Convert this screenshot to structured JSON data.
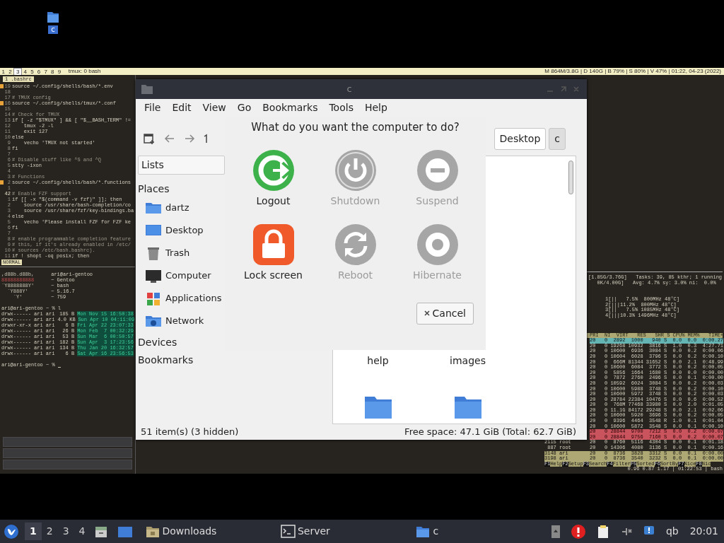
{
  "desktop_icons": [
    {
      "label": "c",
      "selected": true
    }
  ],
  "tmux": {
    "windows": [
      {
        "label": "1",
        "selected": false
      },
      {
        "label": "2",
        "selected": false
      },
      {
        "label": "3",
        "selected": true
      },
      {
        "label": "4",
        "selected": false
      },
      {
        "label": "5",
        "selected": false
      },
      {
        "label": "6",
        "selected": false
      },
      {
        "label": "7",
        "selected": false
      },
      {
        "label": "8",
        "selected": false
      },
      {
        "label": "9",
        "selected": false
      }
    ],
    "title": "tmux: 0 bash",
    "info": "M 864M/3.8G | D 140G | B 79% | S 80% | V 47% | 01:22, 04-23 (2022)"
  },
  "vim": {
    "tab": "1 .bashrc",
    "mode": "NORMAL",
    "lines": [
      {
        "num": "19",
        "text": "source ~/.config/shells/bash/*.env",
        "kind": "code",
        "sign": true
      },
      {
        "num": "18",
        "sign": false
      },
      {
        "num": "17",
        "text": "# TMUX config",
        "kind": "comment",
        "sign": false
      },
      {
        "num": "16",
        "text": "source ~/.config/shells/tmux/*.conf",
        "kind": "code",
        "sign": true
      },
      {
        "num": "15",
        "sign": false
      },
      {
        "num": "14",
        "text": "# Check for TMUX",
        "kind": "comment",
        "sign": false
      },
      {
        "num": "13",
        "text": "if [ -z \"$TMUX\" ] && [ \"$__BASH_TERM\" !=",
        "kind": "code",
        "sign": false
      },
      {
        "num": "12",
        "text": "    tmux -2 -l",
        "kind": "code",
        "sign": false
      },
      {
        "num": "11",
        "text": "    exit 127",
        "kind": "code",
        "sign": false
      },
      {
        "num": "10",
        "text": "else",
        "kind": "code",
        "sign": false
      },
      {
        "num": "9",
        "text": "    vecho 'TMUX not started'",
        "kind": "code",
        "sign": false
      },
      {
        "num": "8",
        "text": "fi",
        "kind": "code",
        "sign": false
      },
      {
        "num": "7",
        "sign": false
      },
      {
        "num": "6",
        "text": "# Disable stuff like ^S and ^Q",
        "kind": "comment",
        "sign": false
      },
      {
        "num": "5",
        "text": "stty -ixon",
        "kind": "code",
        "sign": false
      },
      {
        "num": "4",
        "sign": false
      },
      {
        "num": "3",
        "text": "# Functions",
        "kind": "comment",
        "sign": false
      },
      {
        "num": "2",
        "text": "source ~/.config/shells/bash/*.functions",
        "kind": "code",
        "sign": true
      },
      {
        "num": "1",
        "sign": false
      },
      {
        "num": "42",
        "text": "# Enable FZF support",
        "kind": "comment",
        "sign": false
      },
      {
        "num": "1",
        "text": "if [[ -x \"$(command -v fzf)\" ]]; then",
        "kind": "code",
        "sign": false
      },
      {
        "num": "2",
        "text": "    source /usr/share/bash-completion/co",
        "kind": "code",
        "sign": false
      },
      {
        "num": "3",
        "text": "    source /usr/share/fzf/key-bindings.ba",
        "kind": "code",
        "sign": false
      },
      {
        "num": "4",
        "text": "else",
        "kind": "code",
        "sign": false
      },
      {
        "num": "5",
        "text": "    vecho 'Please install FZF for FZF ke",
        "kind": "code",
        "sign": false
      },
      {
        "num": "6",
        "text": "fi",
        "kind": "code",
        "sign": false
      },
      {
        "num": "7",
        "sign": false
      },
      {
        "num": "8",
        "text": "# enable programmable completion feature",
        "kind": "comment",
        "sign": false
      },
      {
        "num": "9",
        "text": "# this, if it's already enabled in /etc/",
        "kind": "comment",
        "sign": false
      },
      {
        "num": "10",
        "text": "# sources /etc/bash.bashrc).",
        "kind": "comment",
        "sign": false
      },
      {
        "num": "11",
        "text": "if ! shopt -oq posix; then",
        "kind": "code",
        "sign": false
      }
    ]
  },
  "neofetch": {
    "art": [
      ",d88b.d88b,",
      "88888888888",
      "`Y8888888Y'",
      "  `Y888Y'",
      "    `Y'"
    ],
    "info": [
      "ari@ari-gentoo",
      "~ Gentoo",
      "~ bash",
      "~ 5.16.7",
      "~ 759"
    ]
  },
  "shell": {
    "prompt": "ari@ari-gentoo ~ %",
    "command": "l",
    "listing": [
      {
        "perms": "drwx------",
        "owner": "ari ari",
        "size": "185 B",
        "date": "Mon Nov 15 16:50:38"
      },
      {
        "perms": "drwx------",
        "owner": "ari ari",
        "size": "4.0 KB",
        "date": "Sun Apr 10 04:11:09"
      },
      {
        "perms": "drwxr-xr-x",
        "owner": "ari ari",
        "size": "6 B",
        "date": "Fri Apr 22 23:07:33"
      },
      {
        "perms": "drwx------",
        "owner": "ari ari",
        "size": "26 B",
        "date": "Mon Feb  7 00:32:29"
      },
      {
        "perms": "drwx------",
        "owner": "ari ari",
        "size": "53 B",
        "date": "Sun Mar  6 00:50:57"
      },
      {
        "perms": "drwx------",
        "owner": "ari ari",
        "size": "182 B",
        "date": "Sun Apr  3 17:23:56"
      },
      {
        "perms": "drwx------",
        "owner": "ari ari",
        "size": "134 B",
        "date": "Thu Jan 20 16:32:57"
      },
      {
        "perms": "drwx------",
        "owner": "ari ari",
        "size": "6 B",
        "date": "Sat Apr 16 23:56:53"
      }
    ],
    "prompt_end": "ari@ari-gentoo ~ %"
  },
  "htop": {
    "header": [
      "[1.85G/3.76G]   Tasks: 39, 85 kthr; 1 running",
      "   0K/4.00G]   Avg: 4.7% sy: 3.0% ni:  0.0%"
    ],
    "cpus": [
      "1[||   7.5%  800MHz 48°C]",
      "2[|||11.2%  800MHz 48°C]",
      "3[||   7.5% 1085MHz 48°C]",
      "4[|||10.3% 1496MHz 48°C]"
    ],
    "columns": "PRI  NI  VIRT   RES   SHR S CPU% MEM%   TIME+",
    "rows": [
      {
        "kind": "selected",
        "text": "20   0  2892  1000   940 S  0.0  0.0  0:00.27"
      },
      {
        "kind": "normal",
        "text": "20   0 19268 10932  3816 S  1.0  0.3  4:27.71"
      },
      {
        "kind": "normal",
        "text": "20   0 10600  6936  3084 S  0.0  0.2  0:00.06"
      },
      {
        "kind": "normal",
        "text": "20   0 10604  6028  3796 S  0.0  0.2  0:00.10"
      },
      {
        "kind": "normal",
        "text": "20   0  666M 81344 31652 S  0.0  2.1  0:48.99"
      },
      {
        "kind": "normal",
        "text": "20   0 10600  6084  3772 S  0.0  0.2  0:00.05"
      },
      {
        "kind": "normal",
        "text": "20   0  5856  1664  1680 S  0.0  0.0  0:00.00"
      },
      {
        "kind": "normal",
        "text": "20   0  7872  2760  2496 S  0.0  0.1  0:00.00"
      },
      {
        "kind": "normal",
        "text": "20   0 10592  6024  3084 S  0.0  0.2  0:00.03"
      },
      {
        "kind": "normal",
        "text": "20   0 10600  5988  3748 S  0.0  0.2  0:00.10"
      },
      {
        "kind": "normal",
        "text": "20   0 10600  5972  3748 S  0.0  0.2  0:00.03"
      },
      {
        "kind": "normal",
        "text": "20   0 28784 22384 10476 S  0.0  0.6  0:00.52"
      },
      {
        "kind": "normal",
        "text": "20   0  768M 77468 33980 S  0.0  2.0  0:01.05"
      },
      {
        "kind": "normal",
        "text": "20   0 11.1G 84172 29248 S  0.0  2.1  0:02.06"
      },
      {
        "kind": "normal",
        "text": "20   0 10600  5920  3696 S  0.0  0.2  0:00.05"
      },
      {
        "kind": "normal",
        "text": "20   0  9396  4464  3548 R  1.0  0.1  0:01.04"
      },
      {
        "kind": "normal",
        "text": "20   0 10600  5872  3548 S  0.0  0.1  0:00.10"
      },
      {
        "kind": "red",
        "text": "20   0 28844  9700  7212 S  0.0  0.2  0:00.07"
      },
      {
        "kind": "red",
        "text": "20   0 28844  9756  7160 S  0.0  0.2  0:00.07"
      },
      {
        "kind": "normal",
        "pid": "2115 root",
        "text": "20   0  8760  5116  4304 S  0.0  0.1  0:01.18"
      },
      {
        "kind": "normal",
        "pid": " 887 root",
        "text": "20   0 14306  4080  3136 S  0.0  0.1  0:00.16"
      },
      {
        "kind": "yellow",
        "pid": "3148 ari",
        "text": "20   0  8736  3828  3312 S  0.0  0.1  0:00.00"
      },
      {
        "kind": "yellow",
        "pid": "3198 ari",
        "text": "20   0  8736  3540  3232 S  0.0  0.1  0:00.00"
      }
    ],
    "keys": [
      {
        "key": "F1",
        "label": "Help"
      },
      {
        "key": "F2",
        "label": "Setup"
      },
      {
        "key": "F3",
        "label": "Search"
      },
      {
        "key": "F4",
        "label": "Filter"
      },
      {
        "key": "F5",
        "label": "Sorted"
      },
      {
        "key": "F6",
        "label": "SortBy"
      },
      {
        "key": "F7",
        "label": "Nice"
      },
      {
        "key": "F8",
        "label": "Nic"
      }
    ],
    "footer": "0.96 0.87 1.17 | 01:22:53 | bash"
  },
  "file_manager": {
    "title": "c",
    "menu": [
      "File",
      "Edit",
      "View",
      "Go",
      "Bookmarks",
      "Tools",
      "Help"
    ],
    "path": [
      {
        "label": "Desktop",
        "selected": false
      },
      {
        "label": "c",
        "selected": true
      }
    ],
    "lists_label": "Lists",
    "sections": [
      {
        "heading": "Places",
        "items": [
          {
            "label": "dartz",
            "kind": "home"
          },
          {
            "label": "Desktop",
            "kind": "desktop"
          },
          {
            "label": "Trash",
            "kind": "trash"
          },
          {
            "label": "Computer",
            "kind": "computer"
          },
          {
            "label": "Applications",
            "kind": "apps"
          },
          {
            "label": "Network",
            "kind": "network"
          }
        ]
      },
      {
        "heading": "Devices"
      },
      {
        "heading": "Bookmarks"
      }
    ],
    "files": [
      {
        "kind": "label",
        "label": "help"
      },
      {
        "kind": "label",
        "label": "images"
      },
      {
        "kind": "folder"
      },
      {
        "kind": "folder"
      }
    ],
    "status_left": "51 item(s) (3 hidden)",
    "status_right": "Free space: 47.1 GiB (Total: 62.7 GiB)"
  },
  "logout_dialog": {
    "title": "What do you want the computer to do?",
    "actions": [
      {
        "kind": "logout",
        "label": "Logout",
        "disabled": false
      },
      {
        "kind": "shutdown",
        "label": "Shutdown",
        "disabled": true
      },
      {
        "kind": "suspend",
        "label": "Suspend",
        "disabled": true
      },
      {
        "kind": "lock",
        "label": "Lock screen",
        "disabled": false
      },
      {
        "kind": "reboot",
        "label": "Reboot",
        "disabled": true
      },
      {
        "kind": "hibernate",
        "label": "Hibernate",
        "disabled": true
      }
    ],
    "cancel": "Cancel"
  },
  "taskbar": {
    "workspaces": [
      {
        "label": "1",
        "selected": true
      },
      {
        "label": "2",
        "selected": false
      },
      {
        "label": "3",
        "selected": false
      },
      {
        "label": "4",
        "selected": false
      }
    ],
    "tasks": [
      {
        "kind": "downloads",
        "label": "Downloads"
      },
      {
        "kind": "terminal",
        "label": "Server"
      },
      {
        "kind": "folder",
        "label": "c"
      }
    ],
    "tray_label": "qb",
    "clock": "20:01"
  }
}
